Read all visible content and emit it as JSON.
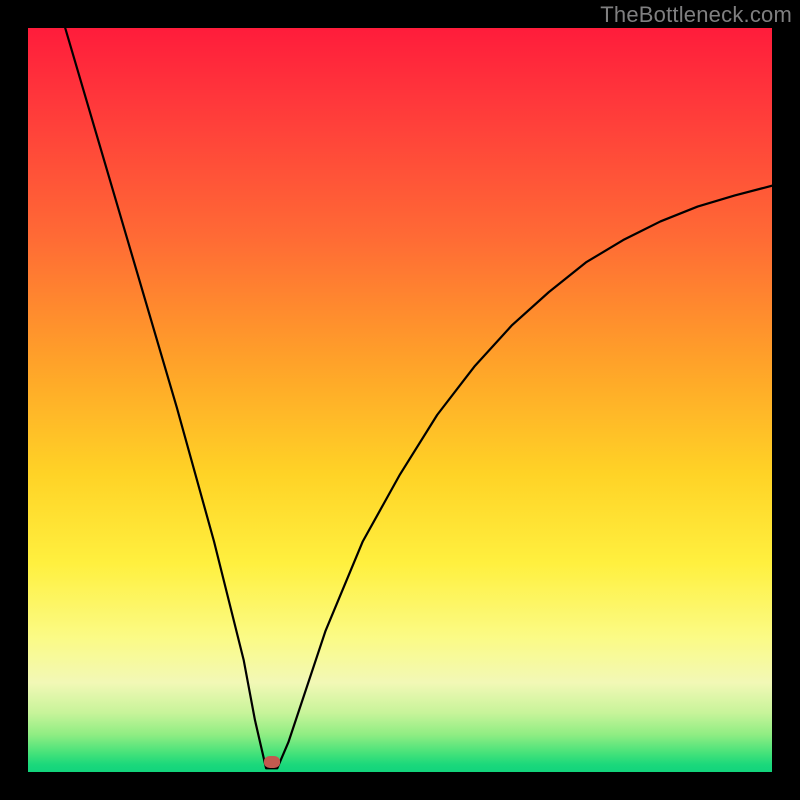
{
  "watermark": "TheBottleneck.com",
  "colors": {
    "page_bg": "#000000",
    "curve": "#000000",
    "dot": "#c35a4f",
    "gradient_stops": [
      "#ff1c3b",
      "#ff383b",
      "#ff6a35",
      "#ffa229",
      "#ffd326",
      "#fff03f",
      "#fbfb86",
      "#f2f8b6",
      "#c8f49a",
      "#8fed83",
      "#44e27a",
      "#1bd87b",
      "#12d47c"
    ]
  },
  "chart_data": {
    "type": "line",
    "title": "",
    "xlabel": "",
    "ylabel": "",
    "xlim": [
      0,
      100
    ],
    "ylim": [
      0,
      100
    ],
    "series": [
      {
        "name": "curve",
        "x": [
          5,
          10,
          15,
          20,
          25,
          27,
          29,
          30.5,
          32,
          33.5,
          35,
          40,
          45,
          50,
          55,
          60,
          65,
          70,
          75,
          80,
          85,
          90,
          95,
          100
        ],
        "y": [
          100,
          83,
          66,
          49,
          31,
          23,
          15,
          7,
          0.5,
          0.5,
          4,
          19,
          31,
          40,
          48,
          54.5,
          60,
          64.5,
          68.5,
          71.5,
          74,
          76,
          77.5,
          78.8
        ]
      }
    ],
    "marker": {
      "x": 32.8,
      "y": 1.4
    },
    "notes": "Values are approximate, read from pixel positions; chart has no visible axes, ticks, or labels. y is a percentage-like quantity where 0 is the green floor and 100 is the top (red). The curve is a V/valley shape bottoming near x≈32."
  }
}
